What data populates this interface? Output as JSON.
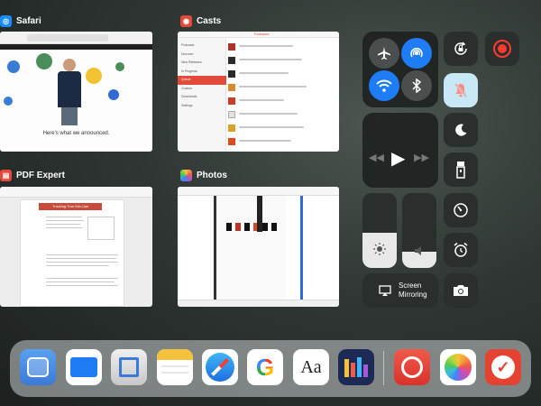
{
  "apps": [
    {
      "name": "Safari",
      "caption": "Here's what we announced."
    },
    {
      "name": "Casts",
      "list_header": "Podcasts",
      "active_tab": "Queue"
    },
    {
      "name": "PDF Expert"
    },
    {
      "name": "Photos"
    }
  ],
  "casts_sidebar": [
    "Podcasts",
    "Discover",
    "New Releases",
    "In Progress",
    "Queue",
    "Custom",
    "Downloads",
    "Settings"
  ],
  "control_center": {
    "screen_mirroring_line1": "Screen",
    "screen_mirroring_line2": "Mirroring",
    "airplane_mode": false,
    "airdrop": true,
    "wifi": true,
    "bluetooth": false,
    "do_not_disturb_active": true,
    "brightness_level": 0.3,
    "volume_level": 0.2
  },
  "dock": [
    "Stacks",
    "Files",
    "Copied",
    "Notes",
    "Safari",
    "Google",
    "Dictionary",
    "Bookmarks",
    "PDF Expert",
    "Photos",
    "Todoist"
  ],
  "pdf_heading": "Tracking Your Mix-Ups",
  "colors": {
    "accent_blue": "#1e7cf5",
    "record_red": "#ff3b30",
    "dnd_pink": "#ff8a80"
  }
}
